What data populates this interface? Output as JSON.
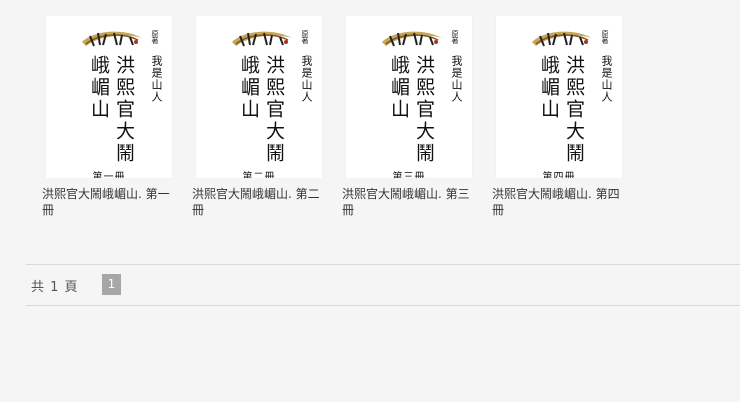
{
  "cover": {
    "author_label": "原著",
    "author": "我是山人",
    "title": "洪熙官大鬧峨嵋山"
  },
  "books": [
    {
      "volume_label": "第一冊",
      "caption": "洪熙官大鬧峨嵋山. 第一冊"
    },
    {
      "volume_label": "第二冊",
      "caption": "洪熙官大鬧峨嵋山. 第二冊"
    },
    {
      "volume_label": "第三冊",
      "caption": "洪熙官大鬧峨嵋山. 第三冊"
    },
    {
      "volume_label": "第四冊",
      "caption": "洪熙官大鬧峨嵋山. 第四冊"
    }
  ],
  "pager": {
    "total_label": "共 1 頁",
    "current_page": "1"
  }
}
